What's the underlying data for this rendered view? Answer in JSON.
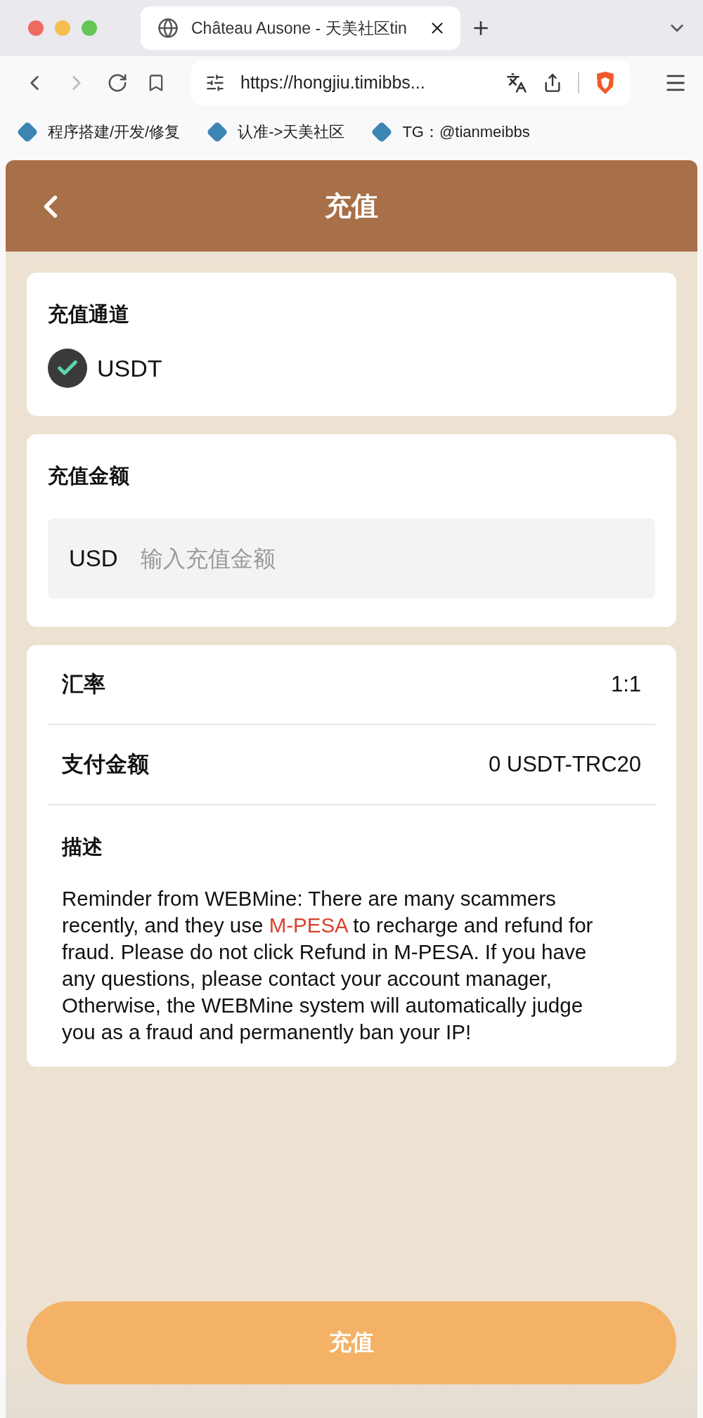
{
  "browser": {
    "tab_title": "Château Ausone - 天美社区tin",
    "url": "https://hongjiu.timibbs...",
    "bookmarks": [
      "程序搭建/开发/修复",
      "认准->天美社区",
      "TG：@tianmeibbs"
    ]
  },
  "page": {
    "title": "充值",
    "channel_card": {
      "heading": "充值通道",
      "options": [
        {
          "label": "USDT",
          "selected": true
        }
      ]
    },
    "amount_card": {
      "heading": "充值金额",
      "currency": "USD",
      "placeholder": "输入充值金额"
    },
    "summary": {
      "rows": [
        {
          "label": "汇率",
          "value": "1:1"
        },
        {
          "label": "支付金额",
          "value": "0 USDT-TRC20"
        }
      ],
      "description": {
        "heading": "描述",
        "segments": [
          {
            "text": "Reminder from WEBMine: There are many scammers recently, and they use ",
            "highlight": false
          },
          {
            "text": "M-PESA",
            "highlight": true
          },
          {
            "text": " to recharge and refund for fraud. Please do not click Refund in M-PESA. If you have any questions, please contact your account manager, Otherwise, the WEBMine system will automatically judge you as a fraud and permanently ban your IP!",
            "highlight": false
          }
        ]
      }
    },
    "submit_button": "充值"
  }
}
